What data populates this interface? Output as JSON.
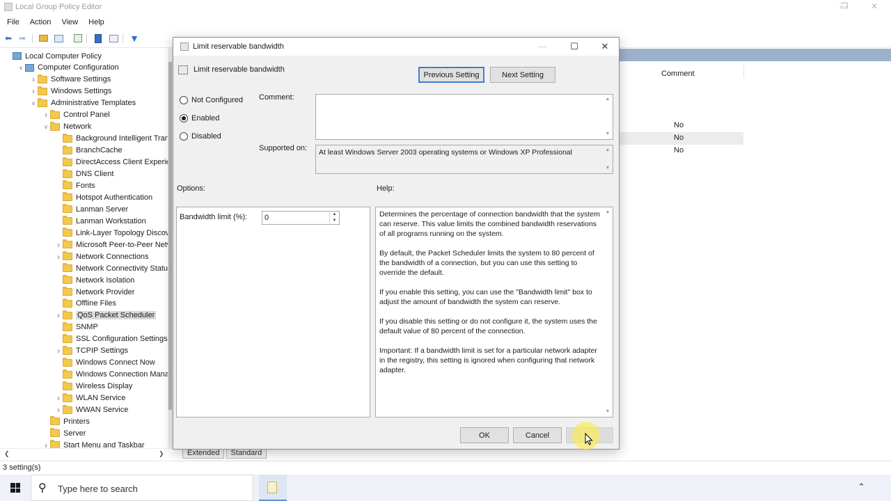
{
  "window": {
    "title": "Local Group Policy Editor"
  },
  "menubar": [
    "File",
    "Action",
    "View",
    "Help"
  ],
  "tree": {
    "items": [
      {
        "label": "Local Computer Policy",
        "indent": 0,
        "expander": "",
        "icon": "computer"
      },
      {
        "label": "Computer Configuration",
        "indent": 1,
        "expander": "open",
        "icon": "computer"
      },
      {
        "label": "Software Settings",
        "indent": 2,
        "expander": "closed",
        "icon": "folder"
      },
      {
        "label": "Windows Settings",
        "indent": 2,
        "expander": "closed",
        "icon": "folder"
      },
      {
        "label": "Administrative Templates",
        "indent": 2,
        "expander": "open",
        "icon": "folder"
      },
      {
        "label": "Control Panel",
        "indent": 3,
        "expander": "closed",
        "icon": "folder"
      },
      {
        "label": "Network",
        "indent": 3,
        "expander": "open",
        "icon": "folder"
      },
      {
        "label": "Background Intelligent Transf",
        "indent": 4,
        "expander": "",
        "icon": "folder"
      },
      {
        "label": "BranchCache",
        "indent": 4,
        "expander": "",
        "icon": "folder"
      },
      {
        "label": "DirectAccess Client Experienc",
        "indent": 4,
        "expander": "",
        "icon": "folder"
      },
      {
        "label": "DNS Client",
        "indent": 4,
        "expander": "",
        "icon": "folder"
      },
      {
        "label": "Fonts",
        "indent": 4,
        "expander": "",
        "icon": "folder"
      },
      {
        "label": "Hotspot Authentication",
        "indent": 4,
        "expander": "",
        "icon": "folder"
      },
      {
        "label": "Lanman Server",
        "indent": 4,
        "expander": "",
        "icon": "folder"
      },
      {
        "label": "Lanman Workstation",
        "indent": 4,
        "expander": "",
        "icon": "folder"
      },
      {
        "label": "Link-Layer Topology Discove",
        "indent": 4,
        "expander": "",
        "icon": "folder"
      },
      {
        "label": "Microsoft Peer-to-Peer Netw",
        "indent": 4,
        "expander": "closed",
        "icon": "folder"
      },
      {
        "label": "Network Connections",
        "indent": 4,
        "expander": "closed",
        "icon": "folder"
      },
      {
        "label": "Network Connectivity Status",
        "indent": 4,
        "expander": "",
        "icon": "folder"
      },
      {
        "label": "Network Isolation",
        "indent": 4,
        "expander": "",
        "icon": "folder"
      },
      {
        "label": "Network Provider",
        "indent": 4,
        "expander": "",
        "icon": "folder"
      },
      {
        "label": "Offline Files",
        "indent": 4,
        "expander": "",
        "icon": "folder"
      },
      {
        "label": "QoS Packet Scheduler",
        "indent": 4,
        "expander": "closed",
        "icon": "folder",
        "selected": true
      },
      {
        "label": "SNMP",
        "indent": 4,
        "expander": "",
        "icon": "folder"
      },
      {
        "label": "SSL Configuration Settings",
        "indent": 4,
        "expander": "",
        "icon": "folder"
      },
      {
        "label": "TCPIP Settings",
        "indent": 4,
        "expander": "closed",
        "icon": "folder"
      },
      {
        "label": "Windows Connect Now",
        "indent": 4,
        "expander": "",
        "icon": "folder"
      },
      {
        "label": "Windows Connection Manag",
        "indent": 4,
        "expander": "",
        "icon": "folder"
      },
      {
        "label": "Wireless Display",
        "indent": 4,
        "expander": "",
        "icon": "folder"
      },
      {
        "label": "WLAN Service",
        "indent": 4,
        "expander": "closed",
        "icon": "folder"
      },
      {
        "label": "WWAN Service",
        "indent": 4,
        "expander": "closed",
        "icon": "folder"
      },
      {
        "label": "Printers",
        "indent": 3,
        "expander": "",
        "icon": "folder"
      },
      {
        "label": "Server",
        "indent": 3,
        "expander": "",
        "icon": "folder"
      },
      {
        "label": "Start Menu and Taskbar",
        "indent": 3,
        "expander": "closed",
        "icon": "folder"
      }
    ]
  },
  "right_pane": {
    "column_comment": "Comment",
    "rows": [
      "No",
      "No",
      "No"
    ]
  },
  "tabs": [
    "Extended",
    "Standard"
  ],
  "status": "3 setting(s)",
  "taskbar": {
    "search_placeholder": "Type here to search"
  },
  "dialog": {
    "title": "Limit reservable bandwidth",
    "setting_name": "Limit reservable bandwidth",
    "previous_button": "Previous Setting",
    "next_button": "Next Setting",
    "radios": [
      {
        "label": "Not Configured",
        "checked": false
      },
      {
        "label": "Enabled",
        "checked": true
      },
      {
        "label": "Disabled",
        "checked": false
      }
    ],
    "comment_label": "Comment:",
    "comment_value": "",
    "supported_label": "Supported on:",
    "supported_value": "At least Windows Server 2003 operating systems or Windows XP Professional",
    "options_label": "Options:",
    "help_label": "Help:",
    "bandwidth_label": "Bandwidth limit (%):",
    "bandwidth_value": "0",
    "help_paragraphs": [
      "Determines the percentage of connection bandwidth that the system can reserve. This value limits the combined bandwidth reservations of all programs running on the system.",
      "By default, the Packet Scheduler limits the system to 80 percent of the bandwidth of a connection, but you can use this setting to override the default.",
      "If you enable this setting, you can use the \"Bandwidth limit\" box to adjust the amount of bandwidth the system can reserve.",
      "If you disable this setting or do not configure it, the system uses the default value of 80 percent of the connection.",
      "Important: If a bandwidth limit is set for a particular network adapter in the registry, this setting is ignored when configuring that network adapter."
    ],
    "ok_button": "OK",
    "cancel_button": "Cancel",
    "apply_button": ""
  },
  "colors": {
    "accent": "#3c7fd6",
    "folder": "#f2c94c",
    "header_blue": "#9cb2cc",
    "cursor_highlight": "#ffeb50"
  }
}
